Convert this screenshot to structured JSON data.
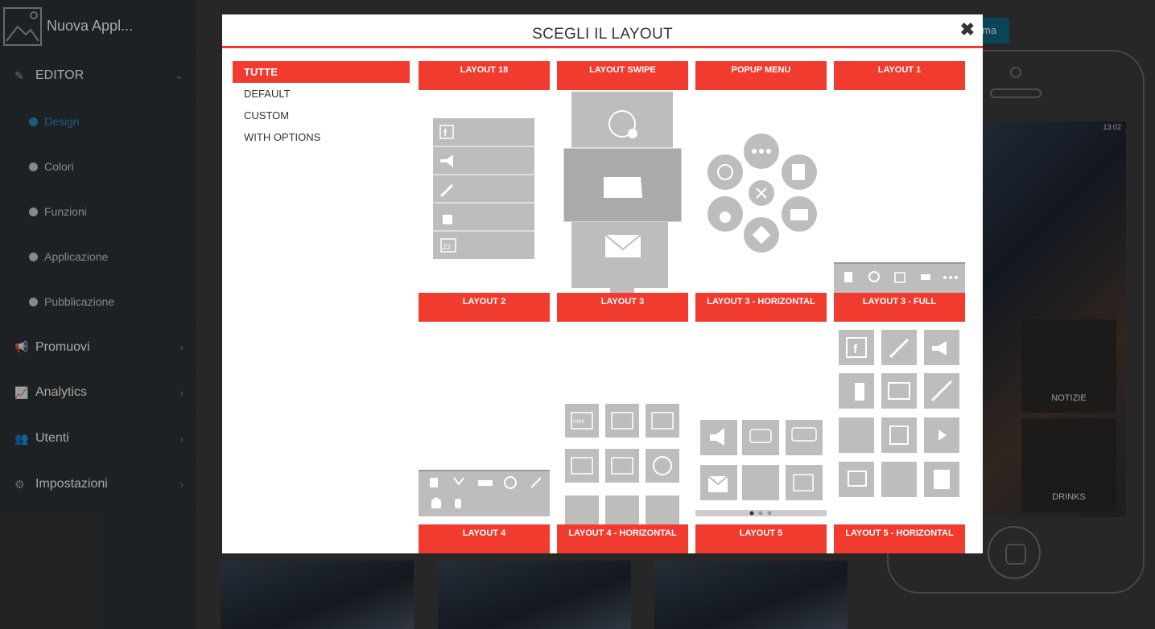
{
  "app": {
    "title": "Nuova Appl..."
  },
  "sidebar": {
    "editor_label": "EDITOR",
    "sub_items": [
      {
        "label": "Design",
        "active": true
      },
      {
        "label": "Colori"
      },
      {
        "label": "Funzioni"
      },
      {
        "label": "Applicazione"
      },
      {
        "label": "Pubblicazione"
      }
    ],
    "sections": [
      {
        "label": "Promuovi"
      },
      {
        "label": "Analytics"
      },
      {
        "label": "Utenti"
      },
      {
        "label": "Impostazioni"
      }
    ]
  },
  "background": {
    "button_label": "ma",
    "phone_status_time": "13:02",
    "phone_tiles": [
      "NOTIZIE",
      "DRINKS"
    ]
  },
  "modal": {
    "title": "SCEGLI IL LAYOUT",
    "close_symbol": "✖",
    "filters": [
      {
        "label": "TUTTE",
        "active": true
      },
      {
        "label": "DEFAULT"
      },
      {
        "label": "CUSTOM"
      },
      {
        "label": "WITH OPTIONS"
      }
    ],
    "layouts": [
      {
        "label": "LAYOUT 18"
      },
      {
        "label": "LAYOUT SWIPE"
      },
      {
        "label": "POPUP MENU"
      },
      {
        "label": "LAYOUT 1"
      },
      {
        "label": "LAYOUT 2"
      },
      {
        "label": "LAYOUT 3"
      },
      {
        "label": "LAYOUT 3 - HORIZONTAL"
      },
      {
        "label": "LAYOUT 3 - FULL"
      }
    ],
    "bottom_layouts": [
      {
        "label": "LAYOUT 4"
      },
      {
        "label": "LAYOUT 4 - HORIZONTAL"
      },
      {
        "label": "LAYOUT 5"
      },
      {
        "label": "LAYOUT 5 - HORIZONTAL"
      }
    ],
    "preview_texts": {
      "calendar_day": "22",
      "unix_label": "UNIX"
    }
  },
  "colors": {
    "accent": "#f23b2f",
    "sidebar_bg": "#2f3336",
    "active_link": "#2a8fc4"
  }
}
